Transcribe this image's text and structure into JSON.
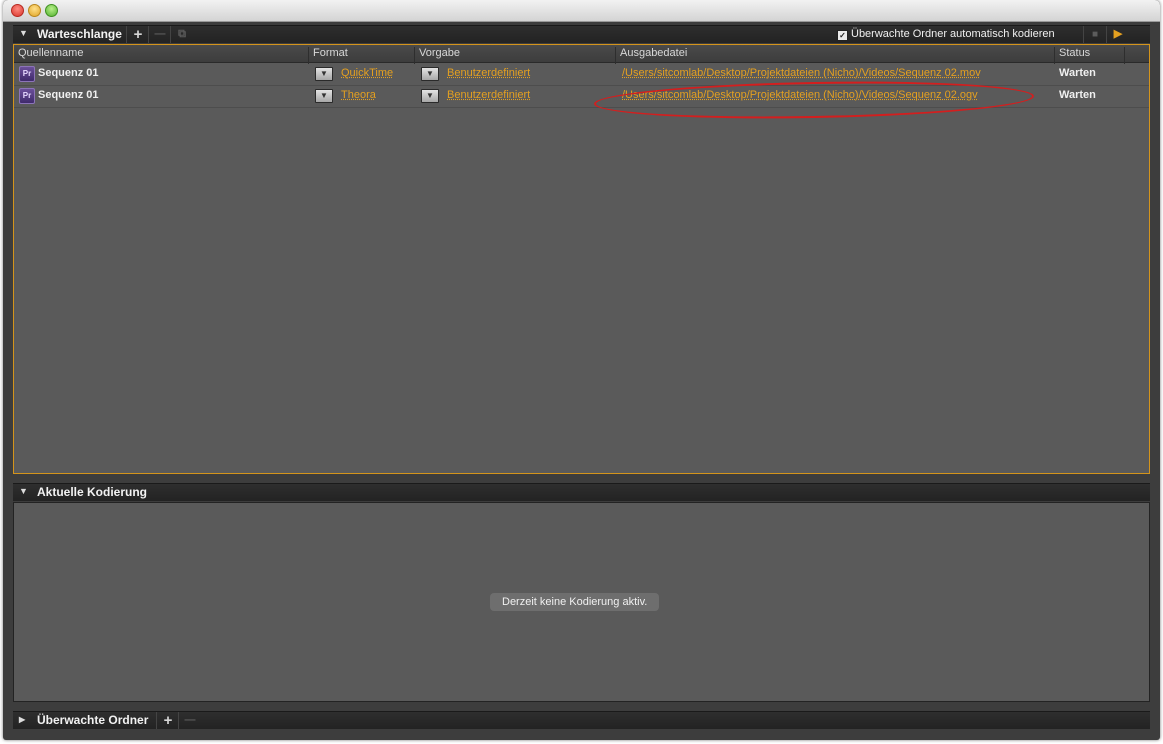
{
  "queue": {
    "title": "Warteschlange",
    "auto_encode_label": "Überwachte Ordner automatisch kodieren",
    "auto_encode_checked": true,
    "columns": [
      "Quellenname",
      "Format",
      "Vorgabe",
      "Ausgabedatei",
      "Status"
    ],
    "rows": [
      {
        "source": "Sequenz 01",
        "format": "QuickTime",
        "preset": "Benutzerdefiniert",
        "output": "/Users/sitcomlab/Desktop/Projektdateien (Nicho)/Videos/Sequenz 02.mov",
        "status": "Warten"
      },
      {
        "source": "Sequenz 01",
        "format": "Theora",
        "preset": "Benutzerdefiniert",
        "output": "/Users/sitcomlab/Desktop/Projektdateien (Nicho)/Videos/Sequenz 02.ogv",
        "status": "Warten"
      }
    ],
    "source_icon_label": "Pr"
  },
  "current": {
    "title": "Aktuelle Kodierung",
    "idle_message": "Derzeit keine Kodierung aktiv."
  },
  "watched": {
    "title": "Überwachte Ordner"
  },
  "icons": {
    "add": "+",
    "remove": "—",
    "duplicate": "⧉",
    "stop": "■",
    "start": "▶",
    "dropdown": "▼",
    "collapse": "▼",
    "expand": "▶",
    "check": "✓"
  },
  "colors": {
    "accent": "#d4941b",
    "link": "#e4a020",
    "annotation": "#d41e1e"
  }
}
